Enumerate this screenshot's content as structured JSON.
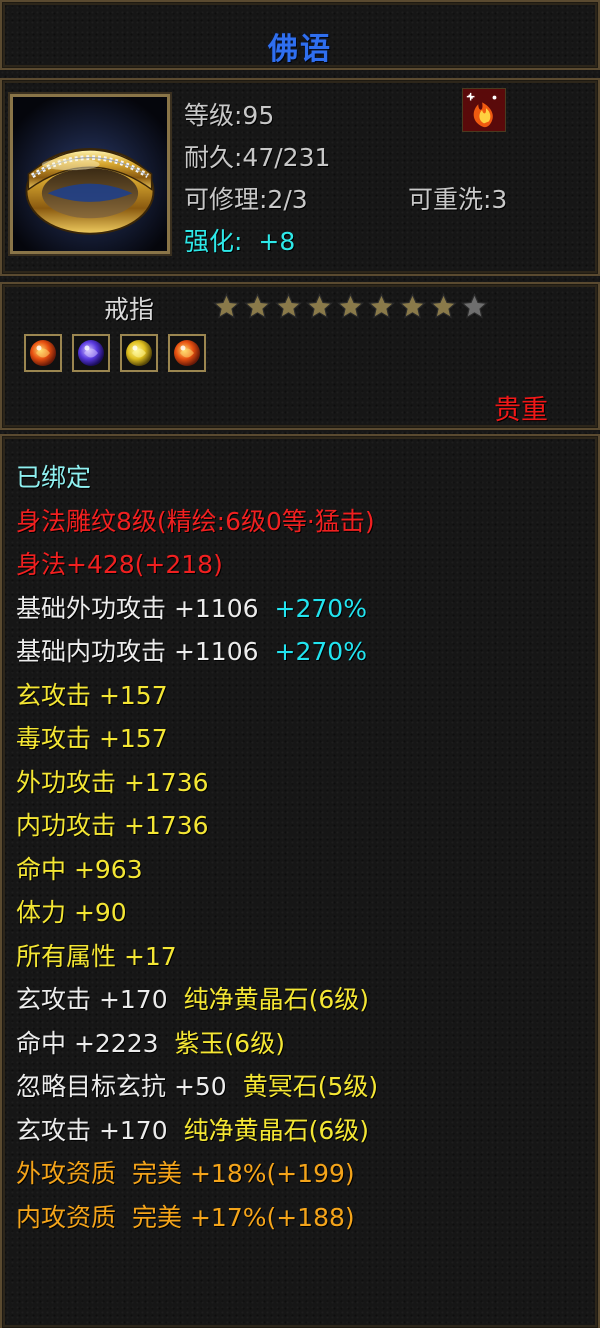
{
  "title": "佛语",
  "header": {
    "level": "等级:95",
    "durability": "耐久:47/231",
    "repair": "可修理:2/3",
    "rewash": "可重洗:3",
    "enhance_label": "强化:",
    "enhance_value": "+8"
  },
  "item": {
    "type": "戒指",
    "stars_filled": 8,
    "stars_total": 9,
    "rarity": "贵重"
  },
  "colors": {
    "title": "#2f6ff0",
    "rarity": "#f01818",
    "star_filled": "#8a7a4a",
    "star_empty": "#6e6e6e",
    "cyan_value": "#22e4f0",
    "yellow_stat": "#f4e634",
    "orange_stat": "#f4a41a"
  },
  "gems": [
    {
      "name": "orange-gem-icon"
    },
    {
      "name": "purple-gem-icon"
    },
    {
      "name": "yellow-gem-icon"
    },
    {
      "name": "orange-gem-icon"
    }
  ],
  "stats": [
    {
      "parts": [
        {
          "text": "已绑定",
          "color": "cyan"
        }
      ]
    },
    {
      "parts": [
        {
          "text": "身法雕纹8级(精绘:6级0等·猛击)",
          "color": "red"
        }
      ]
    },
    {
      "parts": [
        {
          "text": "身法+428(+218)",
          "color": "red"
        }
      ]
    },
    {
      "parts": [
        {
          "text": "基础外功攻击 +1106",
          "color": "white"
        },
        {
          "text": "+270%",
          "color": "bright"
        }
      ]
    },
    {
      "parts": [
        {
          "text": "基础内功攻击 +1106",
          "color": "white"
        },
        {
          "text": "+270%",
          "color": "bright"
        }
      ]
    },
    {
      "parts": [
        {
          "text": "玄攻击 +157",
          "color": "yellow"
        }
      ]
    },
    {
      "parts": [
        {
          "text": "毒攻击 +157",
          "color": "yellow"
        }
      ]
    },
    {
      "parts": [
        {
          "text": "外功攻击 +1736",
          "color": "yellow"
        }
      ]
    },
    {
      "parts": [
        {
          "text": "内功攻击 +1736",
          "color": "yellow"
        }
      ]
    },
    {
      "parts": [
        {
          "text": "命中 +963",
          "color": "yellow"
        }
      ]
    },
    {
      "parts": [
        {
          "text": "体力 +90",
          "color": "yellow"
        }
      ]
    },
    {
      "parts": [
        {
          "text": "所有属性 +17",
          "color": "yellow"
        }
      ]
    },
    {
      "parts": [
        {
          "text": "玄攻击 +170",
          "color": "white"
        },
        {
          "text": "纯净黄晶石(6级)",
          "color": "yellow"
        }
      ]
    },
    {
      "parts": [
        {
          "text": "命中 +2223",
          "color": "white"
        },
        {
          "text": "紫玉(6级)",
          "color": "yellow"
        }
      ]
    },
    {
      "parts": [
        {
          "text": "忽略目标玄抗 +50",
          "color": "white"
        },
        {
          "text": "黄冥石(5级)",
          "color": "yellow"
        }
      ]
    },
    {
      "parts": [
        {
          "text": "玄攻击 +170",
          "color": "white"
        },
        {
          "text": "纯净黄晶石(6级)",
          "color": "yellow"
        }
      ]
    },
    {
      "parts": [
        {
          "text": "外攻资质",
          "color": "orange"
        },
        {
          "text": "完美 +18%(+199)",
          "color": "orange"
        }
      ]
    },
    {
      "parts": [
        {
          "text": "内攻资质",
          "color": "orange"
        },
        {
          "text": "完美 +17%(+188)",
          "color": "orange"
        }
      ]
    }
  ]
}
